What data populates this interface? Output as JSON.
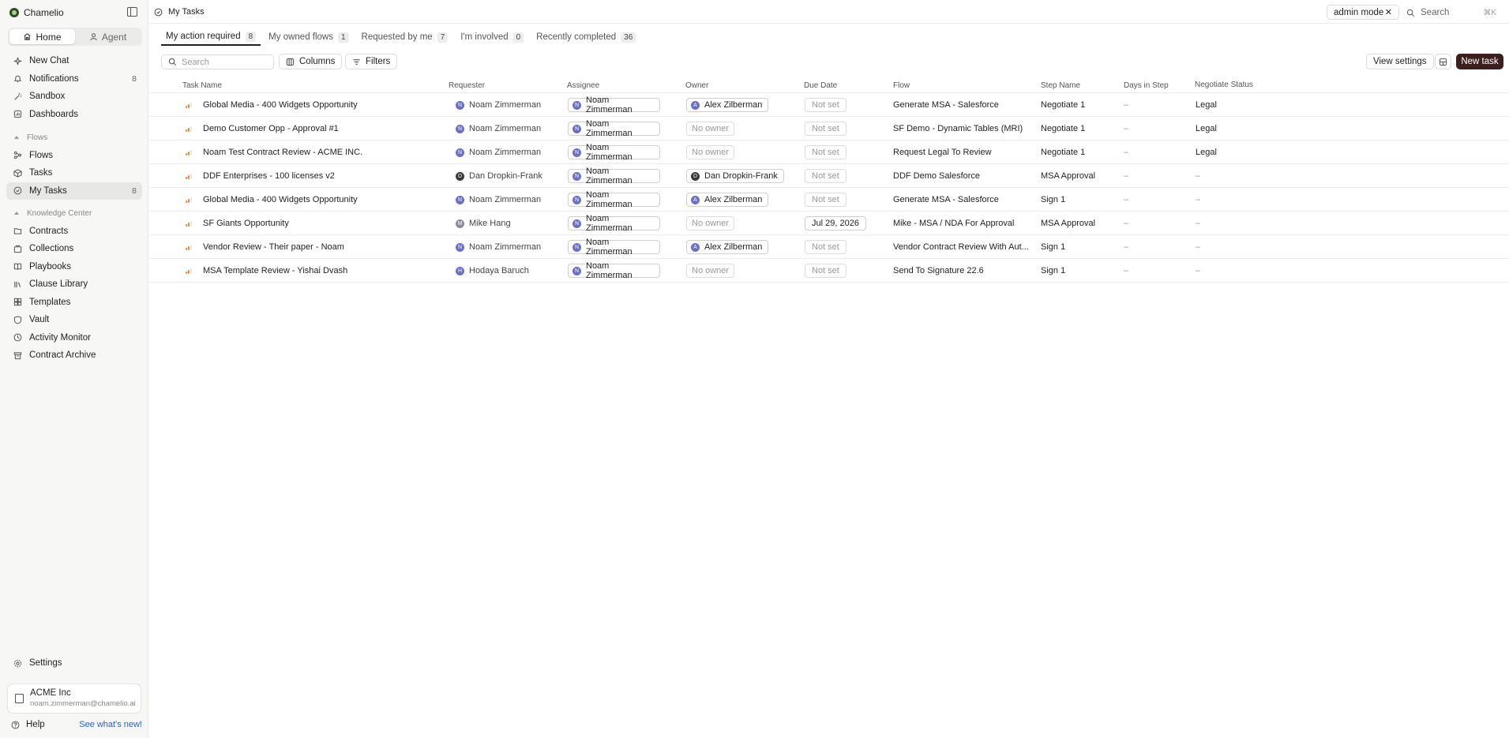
{
  "app": {
    "name": "Chamelio"
  },
  "mode_switch": {
    "home": "Home",
    "agent": "Agent"
  },
  "sidebar": {
    "top_items": [
      {
        "label": "New Chat",
        "icon": "sparkle-icon"
      },
      {
        "label": "Notifications",
        "icon": "bell-icon",
        "count": "8"
      },
      {
        "label": "Sandbox",
        "icon": "wand-icon"
      },
      {
        "label": "Dashboards",
        "icon": "dashboard-icon"
      }
    ],
    "flows_section": "Flows",
    "flows_items": [
      {
        "label": "Flows",
        "icon": "flow-icon"
      },
      {
        "label": "Tasks",
        "icon": "box-icon"
      },
      {
        "label": "My Tasks",
        "icon": "check-circle-icon",
        "count": "8"
      }
    ],
    "knowledge_section": "Knowledge Center",
    "knowledge_items": [
      {
        "label": "Contracts",
        "icon": "contracts-icon"
      },
      {
        "label": "Collections",
        "icon": "collections-icon"
      },
      {
        "label": "Playbooks",
        "icon": "book-icon"
      },
      {
        "label": "Clause Library",
        "icon": "library-icon"
      },
      {
        "label": "Templates",
        "icon": "templates-icon"
      },
      {
        "label": "Vault",
        "icon": "shield-icon"
      },
      {
        "label": "Activity Monitor",
        "icon": "activity-icon"
      },
      {
        "label": "Contract Archive",
        "icon": "archive-icon"
      }
    ],
    "settings": "Settings",
    "org": {
      "name": "ACME Inc",
      "email": "noam.zimmerman@chamelio.ai"
    },
    "help": "Help",
    "whats_new": "See what's new!"
  },
  "header": {
    "breadcrumb": "My Tasks",
    "admin_mode": "admin mode",
    "search_label": "Search",
    "search_shortcut": "⌘K"
  },
  "tabs": [
    {
      "label": "My action required",
      "count": "8"
    },
    {
      "label": "My owned flows",
      "count": "1"
    },
    {
      "label": "Requested by me",
      "count": "7"
    },
    {
      "label": "I'm involved",
      "count": "0"
    },
    {
      "label": "Recently completed",
      "count": "36"
    }
  ],
  "toolbar": {
    "search_placeholder": "Search",
    "columns": "Columns",
    "filters": "Filters",
    "view_settings": "View settings",
    "new_task": "New task"
  },
  "table": {
    "columns": [
      "Task Name",
      "Requester",
      "Assignee",
      "Owner",
      "Due Date",
      "Flow",
      "Step Name",
      "Days in Step",
      "Negotiate Status"
    ],
    "rows": [
      {
        "task": "Global Media - 400 Widgets Opportunity",
        "requester": "Noam Zimmerman",
        "requester_initial": "N",
        "assignee": "Noam Zimmerman",
        "assignee_initial": "N",
        "owner": "Alex Zilberman",
        "owner_initial": "A",
        "due": "Not set",
        "flow": "Generate MSA - Salesforce",
        "step": "Negotiate 1",
        "days": "–",
        "status": "Legal"
      },
      {
        "task": "Demo Customer Opp - Approval #1",
        "requester": "Noam Zimmerman",
        "requester_initial": "N",
        "assignee": "Noam Zimmerman",
        "assignee_initial": "N",
        "owner": "No owner",
        "owner_initial": "",
        "due": "Not set",
        "flow": "SF Demo - Dynamic Tables (MRI)",
        "step": "Negotiate 1",
        "days": "–",
        "status": "Legal"
      },
      {
        "task": "Noam Test Contract Review - ACME INC.",
        "requester": "Noam Zimmerman",
        "requester_initial": "N",
        "assignee": "Noam Zimmerman",
        "assignee_initial": "N",
        "owner": "No owner",
        "owner_initial": "",
        "due": "Not set",
        "flow": "Request Legal To Review",
        "step": "Negotiate 1",
        "days": "–",
        "status": "Legal"
      },
      {
        "task": "DDF Enterprises - 100 licenses v2",
        "requester": "Dan Dropkin-Frank",
        "requester_initial": "D",
        "assignee": "Noam Zimmerman",
        "assignee_initial": "N",
        "owner": "Dan Dropkin-Frank",
        "owner_initial": "D",
        "due": "Not set",
        "flow": "DDF Demo Salesforce",
        "step": "MSA Approval",
        "days": "–",
        "status": "–"
      },
      {
        "task": "Global Media - 400 Widgets Opportunity",
        "requester": "Noam Zimmerman",
        "requester_initial": "N",
        "assignee": "Noam Zimmerman",
        "assignee_initial": "N",
        "owner": "Alex Zilberman",
        "owner_initial": "A",
        "due": "Not set",
        "flow": "Generate MSA - Salesforce",
        "step": "Sign 1",
        "days": "–",
        "status": "–"
      },
      {
        "task": "SF Giants Opportunity",
        "requester": "Mike Hang",
        "requester_initial": "M",
        "assignee": "Noam Zimmerman",
        "assignee_initial": "N",
        "owner": "No owner",
        "owner_initial": "",
        "due": "Jul 29, 2026",
        "flow": "Mike - MSA / NDA For Approval",
        "step": "MSA Approval",
        "days": "–",
        "status": "–"
      },
      {
        "task": "Vendor Review - Their paper - Noam",
        "requester": "Noam Zimmerman",
        "requester_initial": "N",
        "assignee": "Noam Zimmerman",
        "assignee_initial": "N",
        "owner": "Alex Zilberman",
        "owner_initial": "A",
        "due": "Not set",
        "flow": "Vendor Contract Review With Aut...",
        "step": "Sign 1",
        "days": "–",
        "status": "–"
      },
      {
        "task": "MSA Template Review - Yishai Dvash",
        "requester": "Hodaya Baruch",
        "requester_initial": "H",
        "assignee": "Noam Zimmerman",
        "assignee_initial": "N",
        "owner": "No owner",
        "owner_initial": "",
        "due": "Not set",
        "flow": "Send To Signature 22.6",
        "step": "Sign 1",
        "days": "–",
        "status": "–"
      }
    ]
  }
}
